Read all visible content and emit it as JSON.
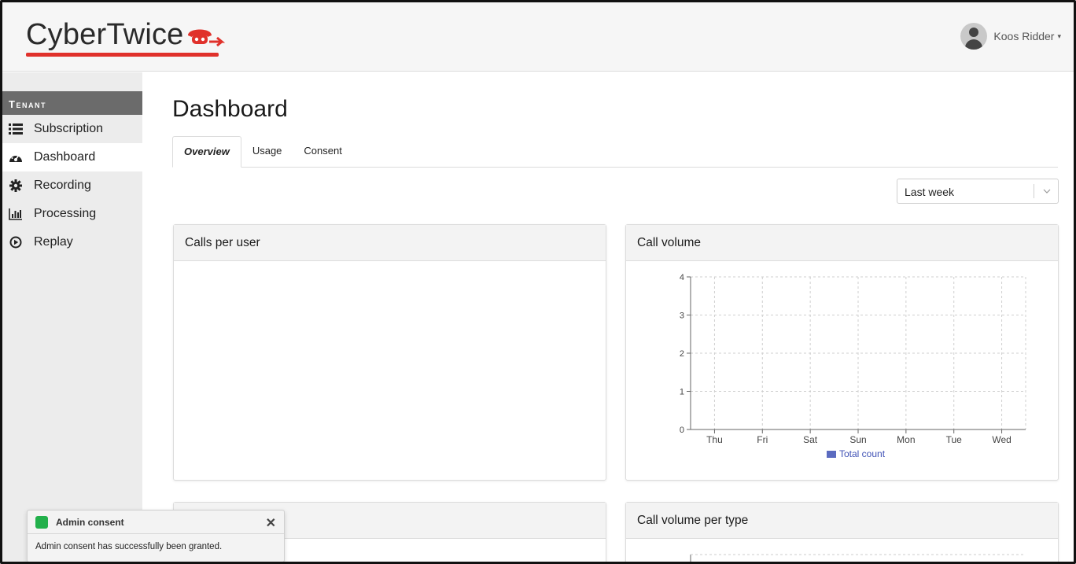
{
  "header": {
    "logo_text": "CyberTwice",
    "user_name": "Koos Ridder",
    "caret": "▾"
  },
  "sidebar": {
    "section_title": "Tenant",
    "items": [
      {
        "label": "Subscription",
        "icon": "list-icon"
      },
      {
        "label": "Dashboard",
        "icon": "tachometer-icon",
        "active": true
      },
      {
        "label": "Recording",
        "icon": "gear-icon"
      },
      {
        "label": "Processing",
        "icon": "bar-chart-icon"
      },
      {
        "label": "Replay",
        "icon": "play-circle-icon"
      }
    ]
  },
  "main": {
    "title": "Dashboard",
    "tabs": [
      {
        "label": "Overview",
        "active": true
      },
      {
        "label": "Usage"
      },
      {
        "label": "Consent"
      }
    ],
    "period_select": {
      "value": "Last week"
    },
    "cards": {
      "calls_per_user": {
        "title": "Calls per user"
      },
      "call_volume": {
        "title": "Call volume"
      },
      "unnamed_card": {
        "title": ""
      },
      "call_volume_per_type": {
        "title": "Call volume per type"
      }
    }
  },
  "chart_data": {
    "type": "bar",
    "categories": [
      "Thu",
      "Fri",
      "Sat",
      "Sun",
      "Mon",
      "Tue",
      "Wed"
    ],
    "series": [
      {
        "name": "Total count",
        "values": [
          0,
          0,
          0,
          0,
          0,
          0,
          0
        ],
        "color": "#5b6bc0"
      }
    ],
    "yticks": [
      "0",
      "1",
      "2",
      "3",
      "4"
    ],
    "ylim": [
      0,
      4
    ],
    "grid": true,
    "legend_position": "bottom"
  },
  "toast": {
    "title": "Admin consent",
    "message": "Admin consent has successfully been granted.",
    "close_symbol": "✕",
    "status_color": "#22b04b"
  },
  "colors": {
    "brand_red": "#e0312b",
    "sidebar_header": "#6b6b6b"
  }
}
